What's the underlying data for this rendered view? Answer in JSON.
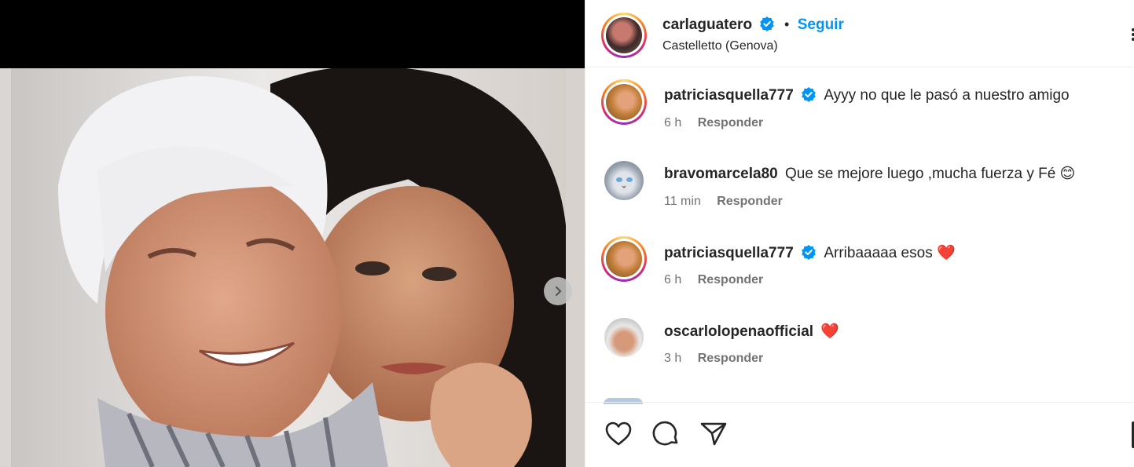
{
  "post": {
    "author": "carlaguatero",
    "separator": "•",
    "follow_label": "Seguir",
    "location": "Castelletto (Genova)"
  },
  "comments": [
    {
      "username": "patriciasquella777",
      "verified": true,
      "text": "Ayyy no que le pasó a nuestro amigo",
      "time": "6 h",
      "reply_label": "Responder"
    },
    {
      "username": "bravomarcela80",
      "verified": false,
      "text": "Que se mejore luego ,mucha fuerza y Fé 😊",
      "time": "11 min",
      "reply_label": "Responder"
    },
    {
      "username": "patriciasquella777",
      "verified": true,
      "text": "Arribaaaaa esos ❤️",
      "time": "6 h",
      "reply_label": "Responder"
    },
    {
      "username": "oscarlolopenaofficial",
      "verified": false,
      "text": "❤️",
      "time": "3 h",
      "reply_label": "Responder"
    }
  ],
  "icons": {
    "like": "heart-icon",
    "comment": "comment-icon",
    "share": "send-icon",
    "save": "bookmark-icon",
    "next": "chevron-right-icon",
    "more": "more-options-icon",
    "verified": "verified-badge-icon"
  },
  "colors": {
    "accent": "#0095f6",
    "verified": "#0095f6",
    "heart": "#ed1c24",
    "text": "#262626",
    "secondary": "#737373"
  }
}
